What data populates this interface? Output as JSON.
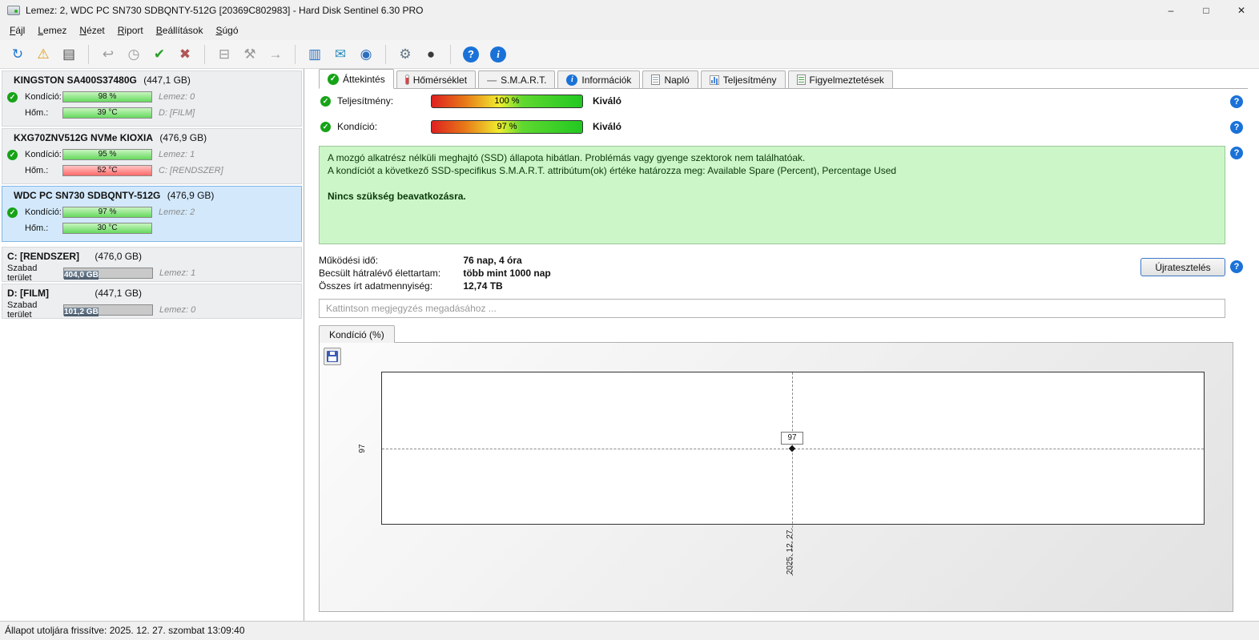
{
  "window": {
    "title": "Lemez: 2, WDC PC SN730 SDBQNTY-512G [20369C802983]  -  Hard Disk Sentinel 6.30 PRO",
    "controls": {
      "minimize": "–",
      "maximize": "□",
      "close": "✕"
    }
  },
  "menu": {
    "items": [
      "Fájl",
      "Lemez",
      "Nézet",
      "Riport",
      "Beállítások",
      "Súgó"
    ]
  },
  "toolbar": {
    "icons": [
      {
        "name": "refresh-icon",
        "glyph": "↻"
      },
      {
        "name": "warning-disk-icon",
        "glyph": "⚠"
      },
      {
        "name": "report-icon",
        "glyph": "▤"
      },
      {
        "name": "undo-icon",
        "glyph": "↩"
      },
      {
        "name": "clock-icon",
        "glyph": "◷"
      },
      {
        "name": "disk-ok-icon",
        "glyph": "✔"
      },
      {
        "name": "disk-remove-icon",
        "glyph": "✖"
      },
      {
        "name": "disk-drive-icon",
        "glyph": "⊟"
      },
      {
        "name": "disk-tools-icon",
        "glyph": "⚒"
      },
      {
        "name": "disk-go-icon",
        "glyph": "→"
      },
      {
        "name": "notes-icon",
        "glyph": "▥"
      },
      {
        "name": "email-icon",
        "glyph": "✉"
      },
      {
        "name": "network-icon",
        "glyph": "◉"
      },
      {
        "name": "settings-gear-icon",
        "glyph": "⚙"
      },
      {
        "name": "dark-disk-icon",
        "glyph": "●"
      },
      {
        "name": "help-icon",
        "glyph": "?"
      },
      {
        "name": "info-icon",
        "glyph": "i"
      }
    ]
  },
  "icons": {
    "check": "✓"
  },
  "sidebar": {
    "disks": [
      {
        "name": "KINGSTON SA400S37480G",
        "size": "(447,1 GB)",
        "condition_label": "Kondíció:",
        "condition_value": "98 %",
        "disk_index": "Lemez: 0",
        "temp_label": "Hőm.:",
        "temp_value": "39 °C",
        "volume": "D: [FILM]"
      },
      {
        "name": "KXG70ZNV512G NVMe KIOXIA",
        "size": "(476,9 GB)",
        "condition_label": "Kondíció:",
        "condition_value": "95 %",
        "disk_index": "Lemez: 1",
        "temp_label": "Hőm.:",
        "temp_value": "52 °C",
        "volume": "C: [RENDSZER]"
      },
      {
        "name": "WDC PC SN730 SDBQNTY-512G",
        "size": "(476,9 GB)",
        "condition_label": "Kondíció:",
        "condition_value": "97 %",
        "disk_index": "Lemez: 2",
        "temp_label": "Hőm.:",
        "temp_value": "30 °C",
        "volume": ""
      }
    ],
    "partitions": [
      {
        "name": "C: [RENDSZER]",
        "size": "(476,0 GB)",
        "free_label": "Szabad terület",
        "free_value": "404,0 GB",
        "disk_index": "Lemez: 1"
      },
      {
        "name": "D: [FILM]",
        "size": "(447,1 GB)",
        "free_label": "Szabad terület",
        "free_value": "101,2 GB",
        "disk_index": "Lemez: 0"
      }
    ]
  },
  "tabs": [
    {
      "label": "Áttekintés",
      "icon": "check-circle-icon",
      "glyph": "✓"
    },
    {
      "label": "Hőmérséklet",
      "icon": "thermometer-icon",
      "glyph": ""
    },
    {
      "label": "S.M.A.R.T.",
      "icon": "smart-dash-icon",
      "glyph": "—"
    },
    {
      "label": "Információk",
      "icon": "info-circle-icon",
      "glyph": "i"
    },
    {
      "label": "Napló",
      "icon": "log-document-icon",
      "glyph": ""
    },
    {
      "label": "Teljesítmény",
      "icon": "performance-chart-icon",
      "glyph": ""
    },
    {
      "label": "Figyelmeztetések",
      "icon": "alerts-document-icon",
      "glyph": ""
    }
  ],
  "overview": {
    "performance_label": "Teljesítmény:",
    "performance_value": "100 %",
    "performance_rating": "Kiváló",
    "condition_label": "Kondíció:",
    "condition_value": "97 %",
    "condition_rating": "Kiváló",
    "status_line1": "A mozgó alkatrész nélküli meghajtó (SSD) állapota hibátlan. Problémás vagy gyenge szektorok nem találhatóak.",
    "status_line2": "A kondíciót a következő SSD-specifikus S.M.A.R.T. attribútum(ok) értéke határozza meg:  Available Spare (Percent), Percentage Used",
    "status_action": "Nincs szükség beavatkozásra.",
    "rows": [
      {
        "label": "Működési idő:",
        "value": "76 nap, 4 óra"
      },
      {
        "label": "Becsült hátralévő élettartam:",
        "value": "több mint 1000 nap"
      },
      {
        "label": "Összes írt adatmennyiség:",
        "value": "12,74 TB"
      }
    ],
    "retest_button": "Újratesztelés",
    "comment_placeholder": "Kattintson megjegyzés megadásához ...",
    "help_glyph": "?"
  },
  "chart": {
    "tab_label": "Kondíció  (%)",
    "point_label": "97",
    "y_tick": "97",
    "x_tick": "2025. 12. 27."
  },
  "chart_data": {
    "type": "line",
    "title": "Kondíció (%)",
    "x": [
      "2025. 12. 27."
    ],
    "values": [
      97
    ],
    "ylabel": "Kondíció (%)",
    "grid": "dashed-crosshair",
    "legend": "none"
  },
  "statusbar": {
    "text": "Állapot utoljára frissítve: 2025. 12. 27. szombat 13:09:40"
  }
}
